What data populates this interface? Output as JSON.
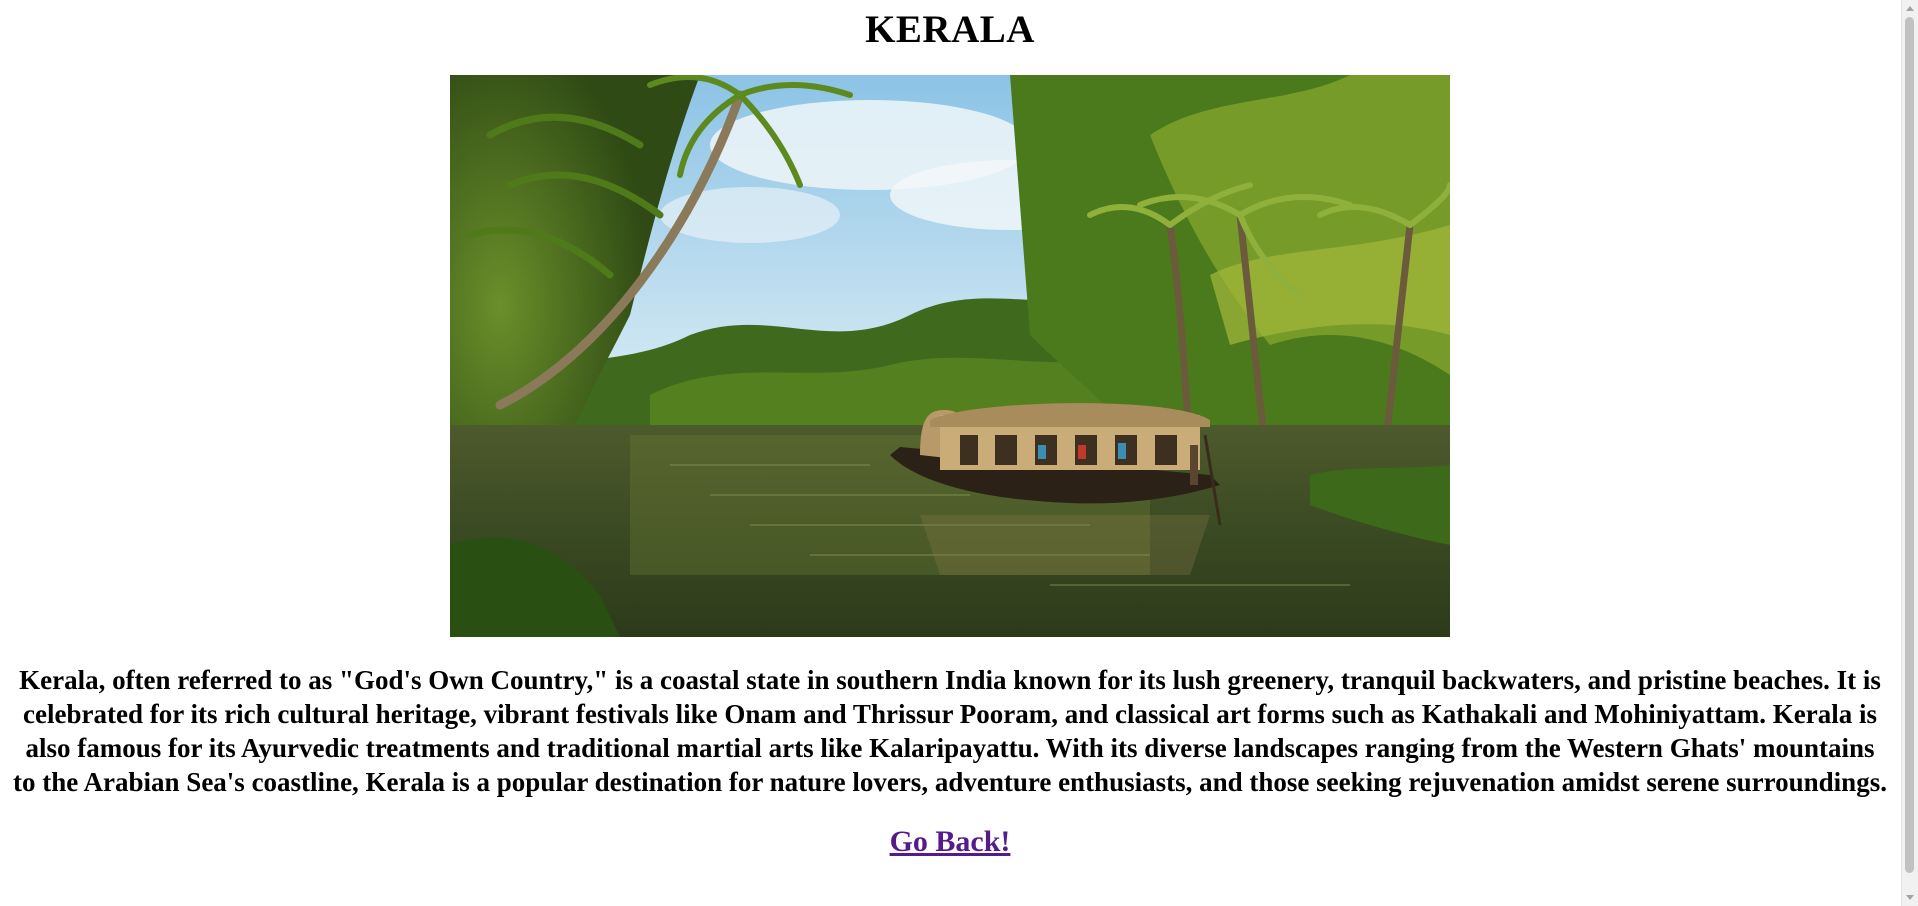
{
  "page": {
    "title": "KERALA",
    "image_alt": "Kerala backwaters houseboat among coconut palms",
    "description": "Kerala, often referred to as \"God's Own Country,\" is a coastal state in southern India known for its lush greenery, tranquil backwaters, and pristine beaches. It is celebrated for its rich cultural heritage, vibrant festivals like Onam and Thrissur Pooram, and classical art forms such as Kathakali and Mohiniyattam. Kerala is also famous for its Ayurvedic treatments and traditional martial arts like Kalaripayattu. With its diverse landscapes ranging from the Western Ghats' mountains to the Arabian Sea's coastline, Kerala is a popular destination for nature lovers, adventure enthusiasts, and those seeking rejuvenation amidst serene surroundings.",
    "back_link": "Go Back!"
  },
  "colors": {
    "link_visited": "#551a8b",
    "text": "#000000",
    "background": "#ffffff"
  }
}
